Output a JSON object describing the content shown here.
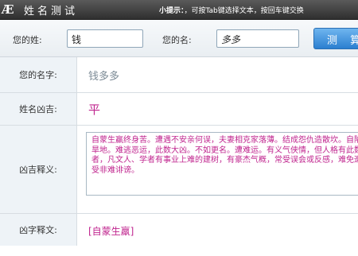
{
  "app": {
    "title": "姓名测试",
    "hint_prefix": "小提示：",
    "hint_text": "，可按Tab键选择文本，按回车键交换"
  },
  "form": {
    "surname_label": "您的姓:",
    "surname_value": "钱",
    "given_label": "您的名:",
    "given_value": "多多",
    "test_button": "测 算"
  },
  "results": {
    "name_label": "您的名字:",
    "name_value": "钱多多",
    "luck_label": "姓名凶吉:",
    "luck_value": "平",
    "desc_label": "凶吉释义:",
    "desc_value": "自蒙生羸终身苦。遭遇不安亲何误，夫妻相克家落薄。结成怨仇造散坎。自陷旱地。难逃恶运，此数大凶。不如更名。遭难运。有义气侠情，但人格有此数者，凡文人、学者有事业上难的建树，有豪杰气概，常受误会或反感，难免遭受非难诽谤。",
    "tag_label": "凶字释文:",
    "tag_value": "[自蒙生羸]"
  }
}
